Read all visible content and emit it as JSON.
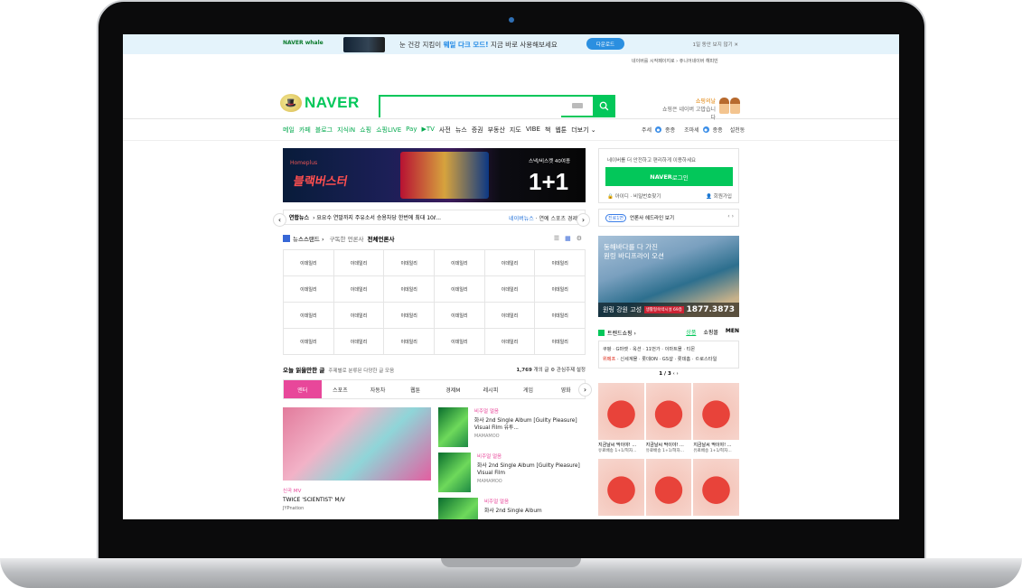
{
  "topbar": {
    "brand": "NAVER whale",
    "text_prefix": "눈 건강 지킴이 ",
    "text_highlight": "웨일 다크 모드!",
    "text_suffix": " 지금 바로 사용해보세요",
    "download_label": "다운로드",
    "close_label": "1일 동안 보지 않기"
  },
  "header": {
    "util_links": "네이버를 시작페이지로  ›       쥬니어네이버   해피빈",
    "logo_text": "NAVER",
    "search_placeholder": "",
    "promo_title": "쇼핑의날",
    "promo_sub": "쇼핑은 네이버 고맙습니다"
  },
  "nav": {
    "items": [
      "메일",
      "카페",
      "블로그",
      "지식iN",
      "쇼핑",
      "쇼핑LIVE",
      "Pay",
      "▶TV",
      "사전",
      "뉴스",
      "증권",
      "부동산",
      "지도",
      "VIBE",
      "책",
      "웹툰",
      "더보기 ⌄"
    ],
    "right": [
      "주세",
      "종종",
      "조마세",
      "종종",
      "설천동"
    ]
  },
  "ad_banner": {
    "brand": "Homeplus",
    "title": "블랙버스터",
    "sub": "스낵/비스켓 40여종",
    "big": "1+1"
  },
  "ticker": {
    "source": "연합뉴스",
    "headline": "› 요요수 연말까지 주유소서 승용차당 한번에 최대 10ℓ...",
    "links": [
      "네이버뉴스",
      "연예",
      "스포츠",
      "경제"
    ]
  },
  "newsstand": {
    "title": "뉴스스탠드 ›",
    "sub": "구독한 언론사",
    "all": "전체언론사",
    "press": [
      "이데일리",
      "이데일리",
      "이데일리",
      "이데일리",
      "이데일리",
      "이데일리",
      "이데일리",
      "이데일리",
      "이데일리",
      "이데일리",
      "이데일리",
      "이데일리",
      "이데일리",
      "이데일리",
      "이데일리",
      "이데일리",
      "이데일리",
      "이데일리",
      "이데일리",
      "이데일리",
      "이데일리",
      "이데일리",
      "이데일리",
      "이데일리"
    ]
  },
  "reads": {
    "title": "오늘 읽을만한 글",
    "sub": "주제별로 분류된 다양한 글 모음",
    "count": "1,769",
    "count_suffix": " 개의 글   ⚙ 관심주제 설정",
    "tabs": [
      "엔터",
      "스포츠",
      "자동차",
      "웹툰",
      "경제M",
      "레시피",
      "게임",
      "영화"
    ]
  },
  "feed": {
    "main": {
      "category": "신곡 MV",
      "title": "TWICE 'SCIENTIST' M/V",
      "source": "JYPnation"
    },
    "items": [
      {
        "category": "비주얼 얼음",
        "title": "화사 2nd Single Album [Guilty Pleasure] Visual Film 유투...",
        "source": "MAMAMOO"
      },
      {
        "category": "비주얼 얼음",
        "title": "화사 2nd Single Album [Guilty Pleasure] Visual Film",
        "source": "MAMAMOO"
      },
      {
        "category": "비주얼 얼음",
        "title": "화사 2nd Single Album",
        "source": ""
      }
    ]
  },
  "login": {
    "message": "네이버를 더 안전하고 편리하게 이용하세요",
    "button_brand": "NAVER",
    "button_label": " 로그인",
    "find": "🔒 아이디 · 비밀번호찾기",
    "join": "👤 회원가입"
  },
  "notice": {
    "badge": "진로1면",
    "text": "언론사 헤드라인 보기",
    "arrows": "‹  ›"
  },
  "side_ad": {
    "line1": "동해바다를 다 가진",
    "line2": "원링 바디프라이 오션",
    "name": "원링 강원 고성",
    "tag": "생활형숙박시설 69층",
    "phone": "1877.3873"
  },
  "trend": {
    "title": "트렌드쇼핑 ›",
    "tabs": [
      "상품",
      "쇼핑몰",
      "MEN"
    ],
    "cats_line1": "쿠팡  ·  G마켓  ·  옥션  ·  11번가  ·  이마트몰  ·  티몬",
    "cats_line2_red": "위메프",
    "cats_line2": "  ·  신세계몰  ·  롯데ON  ·  GS샵  ·  롯데홈  ·  ©로스타일",
    "page": "1 / 3",
    "products": [
      {
        "name": "지금날씨 딱이야! ...",
        "sub": "유료배송 1+1/혁자..."
      },
      {
        "name": "지금날씨 딱이야! ...",
        "sub": "유료배송 1+1/혁자..."
      },
      {
        "name": "지금날씨 딱이야! ...",
        "sub": "유료배송 1+1/혁자..."
      },
      {
        "name": "",
        "sub": ""
      },
      {
        "name": "",
        "sub": ""
      },
      {
        "name": "",
        "sub": ""
      }
    ]
  },
  "colors": {
    "brand": "#03c75a",
    "accent_pink": "#e8479a",
    "link_blue": "#1e6fd9"
  },
  "icons": [
    "search-icon",
    "keyboard-icon",
    "gear-icon",
    "list-view-icon",
    "grid-view-icon",
    "chevron-left-icon",
    "chevron-right-icon",
    "mail-icon"
  ]
}
